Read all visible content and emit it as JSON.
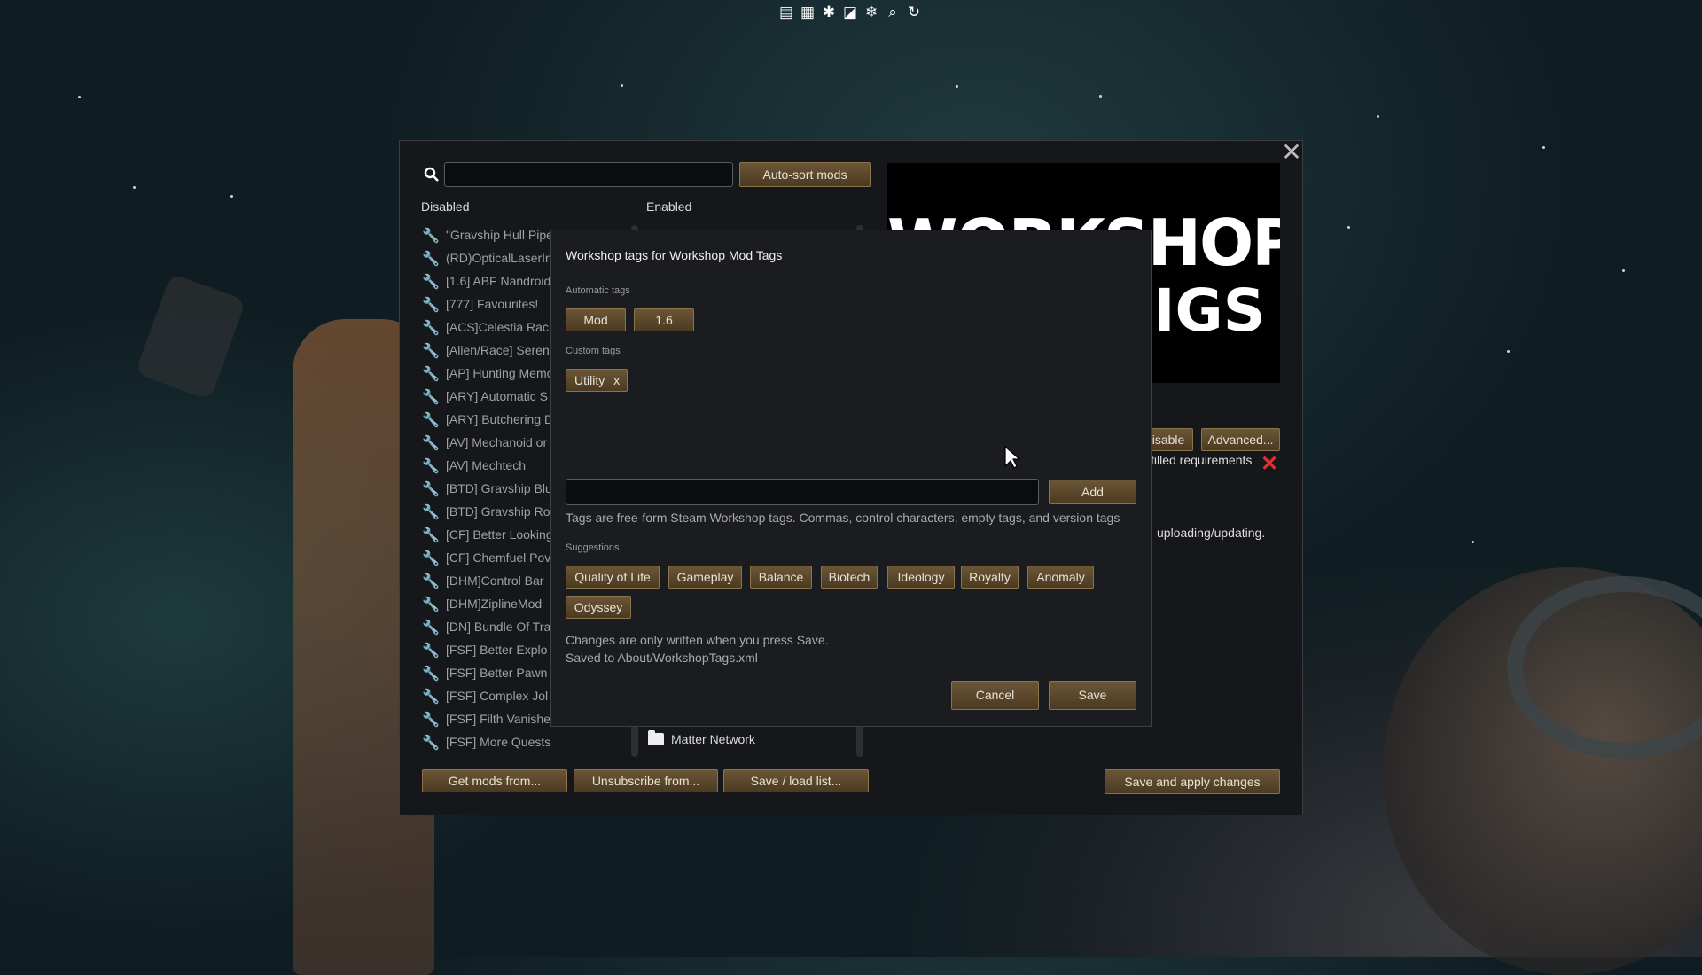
{
  "top_toolbar": {
    "icons": [
      "list-icon",
      "grid-icon",
      "debug-icon",
      "window-icon",
      "snowflake-icon",
      "search-icon",
      "refresh-icon"
    ]
  },
  "search": {
    "value": "",
    "placeholder": ""
  },
  "toolbar": {
    "autosort_label": "Auto-sort mods"
  },
  "columns": {
    "disabled_label": "Disabled",
    "enabled_label": "Enabled"
  },
  "disabled_mods": [
    "\"Gravship Hull Pipe",
    "(RD)OpticalLaserIn",
    "[1.6] ABF Nandroid",
    "[777] Favourites!",
    "[ACS]Celestia Rac",
    "[Alien/Race] Seren",
    "[AP] Hunting Memo",
    "[ARY] Automatic S",
    "[ARY] Butchering D",
    "[AV] Mechanoid or",
    "[AV] Mechtech",
    "[BTD] Gravship Blu",
    "[BTD] Gravship Ro",
    "[CF] Better Looking",
    "[CF] Chemfuel Pov",
    "[DHM]Control Bar",
    "[DHM]ZiplineMod",
    "[DN] Bundle Of Tra",
    "[FSF] Better Explo",
    "[FSF] Better Pawn",
    "[FSF] Complex Jol",
    "[FSF] Filth Vanishe",
    "[FSF] More Quests"
  ],
  "enabled_mods": [
    "Matter Network"
  ],
  "preview": {
    "line1": "WORKSHOP",
    "line2": "IGS"
  },
  "side_panel": {
    "disable_label": "Disable",
    "advanced_label": "Advanced...",
    "requirements_text": "filled requirements",
    "upload_text": "uploading/updating."
  },
  "bottom_buttons": {
    "get_mods": "Get mods from...",
    "unsubscribe": "Unsubscribe from...",
    "save_load": "Save / load list...",
    "save_apply": "Save and apply changes"
  },
  "dialog": {
    "title": "Workshop tags for Workshop Mod Tags",
    "automatic_label": "Automatic tags",
    "automatic_tags": [
      "Mod",
      "1.6"
    ],
    "custom_label": "Custom tags",
    "custom_tags": [
      {
        "label": "Utility",
        "remove": "x"
      }
    ],
    "input_value": "",
    "add_label": "Add",
    "hint": "Tags are free-form Steam Workshop tags. Commas, control characters, empty tags, and version tags",
    "suggestions_label": "Suggestions",
    "suggestions": [
      "Quality of Life",
      "Gameplay",
      "Balance",
      "Biotech",
      "Ideology",
      "Royalty",
      "Anomaly",
      "Odyssey"
    ],
    "note_line1": "Changes are only written when you press Save.",
    "note_line2": "Saved to About/WorkshopTags.xml",
    "cancel_label": "Cancel",
    "save_label": "Save"
  },
  "colors": {
    "button": "#5b4a2d",
    "dialog_bg": "#1b1c1f",
    "window_bg": "#15171a",
    "error": "#e03030"
  }
}
